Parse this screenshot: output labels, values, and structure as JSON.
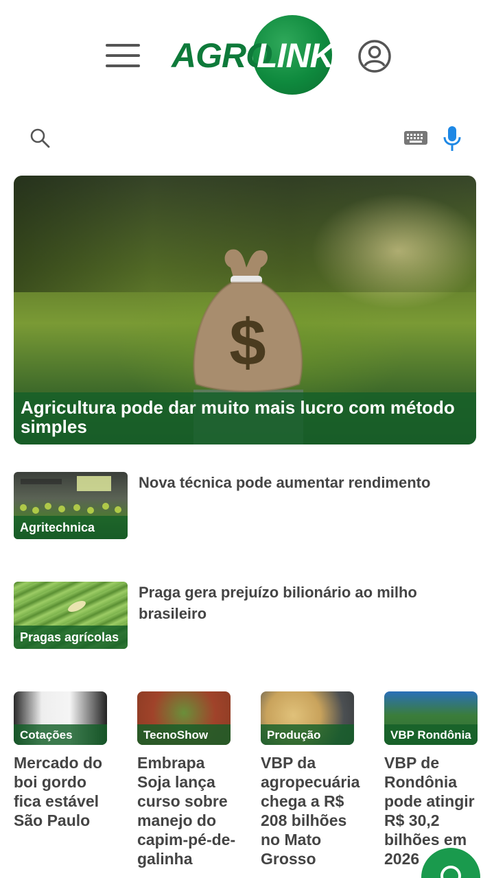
{
  "header": {
    "brand_left": "AGRO",
    "brand_right": "LINK"
  },
  "search": {
    "value": "",
    "placeholder": ""
  },
  "icons": {
    "menu": "hamburger-menu-icon",
    "user": "user-account-icon",
    "search": "search-icon",
    "keyboard": "keyboard-icon",
    "mic": "microphone-icon",
    "chat": "chat-icon"
  },
  "colors": {
    "brand_green": "#0e7a3a",
    "overlay_green": "#145f28",
    "mic_blue": "#1e88e5",
    "fab_green": "#1a9a4d"
  },
  "hero": {
    "title": "Agricultura pode dar muito mais lucro com método simples"
  },
  "list": [
    {
      "tag": "Agritechnica",
      "title": "Nova técnica pode aumentar rendimento"
    },
    {
      "tag": "Pragas agrícolas",
      "title": "Praga gera prejuízo bilionário ao milho brasileiro"
    }
  ],
  "cards": [
    {
      "tag": "Cotações",
      "title": "Mercado do boi gordo fica estável São Paulo"
    },
    {
      "tag": "TecnoShow",
      "title": "Embrapa Soja lança curso sobre manejo do capim-pé-de-galinha"
    },
    {
      "tag": "Produção",
      "title": "VBP da agropecuária chega a R$ 208 bilhões no Mato Grosso"
    },
    {
      "tag": "VBP Rondônia",
      "title": "VBP de Rondônia pode atingir R$ 30,2 bilhões em 2026"
    }
  ]
}
